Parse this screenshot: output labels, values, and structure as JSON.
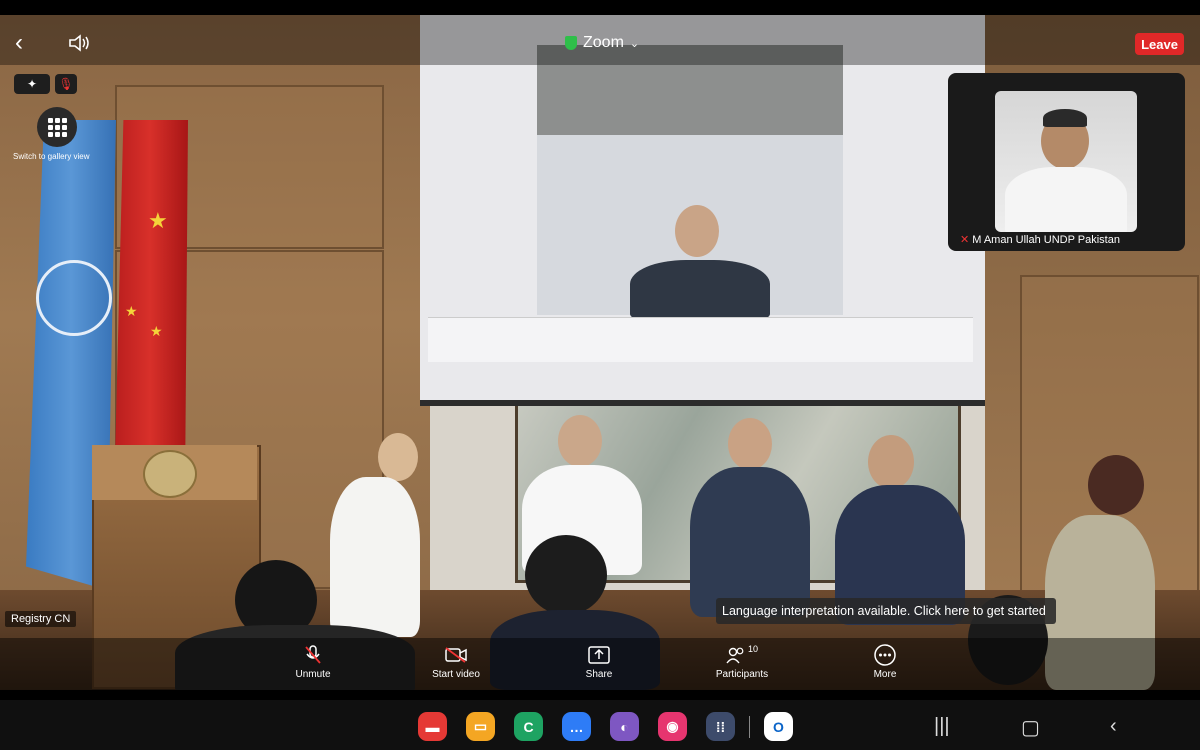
{
  "meeting": {
    "title": "Zoom",
    "leave_label": "Leave",
    "gallery_label": "Switch to gallery view",
    "room_name_tag": "Registry CN"
  },
  "pip": {
    "participant_name": "M Aman Ullah UNDP Pakistan"
  },
  "notification": {
    "text": "Language interpretation available. Click here to get started"
  },
  "toolbar": {
    "unmute": "Unmute",
    "start_video": "Start video",
    "share": "Share",
    "participants": "Participants",
    "participants_count": "10",
    "more": "More"
  },
  "icons": {
    "back": "back-arrow-icon",
    "speaker": "speaker-icon",
    "security": "shield-icon",
    "gallery": "grid-icon"
  },
  "colors": {
    "leave": "#e02828",
    "security": "#2fbf4a"
  }
}
